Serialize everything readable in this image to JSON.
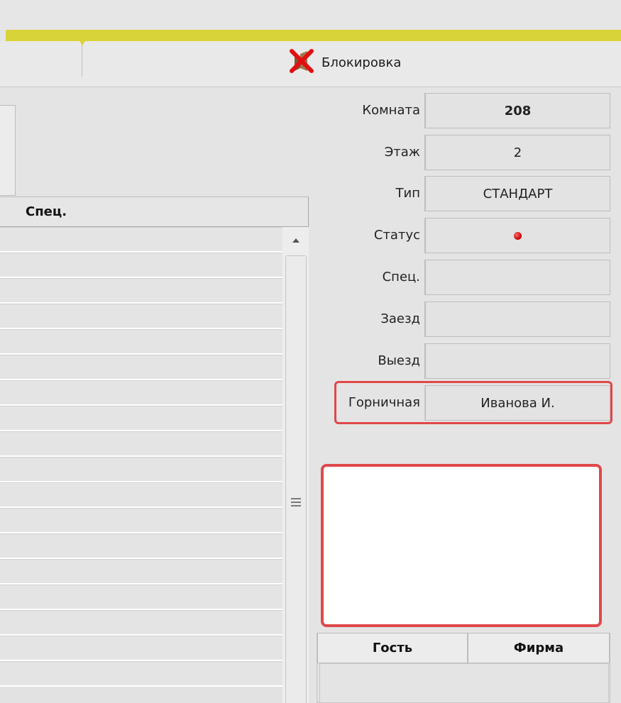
{
  "toolbar": {
    "block_label": "Блокировка"
  },
  "left_table": {
    "column_header": "Спец."
  },
  "properties": {
    "room_label": "Комната",
    "room_value": "208",
    "floor_label": "Этаж",
    "floor_value": "2",
    "type_label": "Тип",
    "type_value": "СТАНДАРТ",
    "status_label": "Статус",
    "status_color": "#cc0000",
    "special_label": "Спец.",
    "special_value": "",
    "checkin_label": "Заезд",
    "checkin_value": "",
    "checkout_label": "Выезд",
    "checkout_value": "",
    "maid_label": "Горничная",
    "maid_value": "Иванова И."
  },
  "guests_table": {
    "guest_header": "Гость",
    "company_header": "Фирма"
  },
  "colors": {
    "accent_yellow": "#d9d33a",
    "highlight_red": "#e0484a"
  },
  "icons": {
    "block": "blocked-cross-icon",
    "scroll_up": "arrow-up-icon",
    "grip": "scroll-grip-icon"
  }
}
